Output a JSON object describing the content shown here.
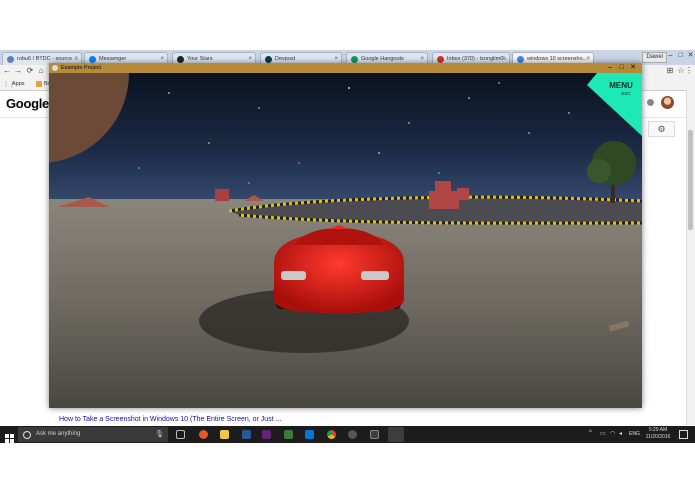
{
  "browser": {
    "tabs": [
      {
        "label": "robu6 / BTDC - source ...",
        "color": "#5b7fc7"
      },
      {
        "label": "Messenger",
        "color": "#0084ff"
      },
      {
        "label": "Your Stars",
        "color": "#222222"
      },
      {
        "label": "Devpost",
        "color": "#003e54"
      },
      {
        "label": "Google Hangouts",
        "color": "#0f9d58"
      },
      {
        "label": "Inbox (370) - tzonglim0...",
        "color": "#d93025"
      },
      {
        "label": "windows 10 screensho...",
        "color": "#4285f4"
      }
    ],
    "window_user": "Dawei",
    "bookmarks": [
      "Apps",
      "Bo"
    ],
    "google_logo": "Google",
    "result_link": "How to Take a Screenshot in Windows 10 (The Entire Screen, or Just ..."
  },
  "game": {
    "window_title": "Example Project",
    "menu_label": "MENU",
    "menu_sub": "ESC",
    "accent_color": "#1de9b6",
    "car_color": "#d11a14"
  },
  "taskbar": {
    "search_placeholder": "Ask me anything",
    "language": "ENG",
    "time": "5:29 AM",
    "date": "11/20/2016"
  }
}
